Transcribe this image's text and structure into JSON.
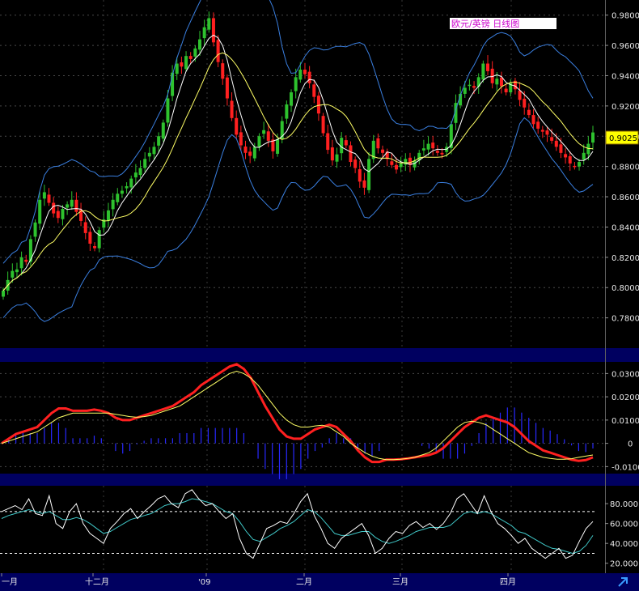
{
  "chart_data": [
    {
      "type": "candlestick",
      "title": "欧元/英镑  日线图",
      "last_value_label": "0.9025",
      "ylim": [
        0.76,
        0.99
      ],
      "yticks": [
        "0.9800",
        "0.9600",
        "0.9400",
        "0.9200",
        "0.9000",
        "0.8800",
        "0.8600",
        "0.8400",
        "0.8200",
        "0.8000",
        "0.7800"
      ],
      "overlays": [
        "bollinger-upper",
        "bollinger-lower",
        "moving-average-fast",
        "moving-average-slow"
      ],
      "colors": {
        "up": "#2ec22e",
        "down": "#ff2020",
        "bollinger": "#3a7fe0",
        "ma_fast": "#ffffff",
        "ma_slow": "#ffff66"
      },
      "closes": [
        0.798,
        0.805,
        0.811,
        0.812,
        0.82,
        0.817,
        0.832,
        0.843,
        0.858,
        0.863,
        0.856,
        0.849,
        0.846,
        0.852,
        0.855,
        0.858,
        0.85,
        0.844,
        0.836,
        0.829,
        0.826,
        0.838,
        0.845,
        0.851,
        0.858,
        0.862,
        0.864,
        0.867,
        0.872,
        0.876,
        0.879,
        0.885,
        0.889,
        0.893,
        0.9,
        0.909,
        0.925,
        0.942,
        0.948,
        0.946,
        0.953,
        0.951,
        0.958,
        0.964,
        0.972,
        0.978,
        0.962,
        0.949,
        0.938,
        0.925,
        0.912,
        0.901,
        0.894,
        0.889,
        0.887,
        0.893,
        0.9,
        0.904,
        0.897,
        0.89,
        0.898,
        0.91,
        0.921,
        0.929,
        0.939,
        0.944,
        0.941,
        0.935,
        0.926,
        0.915,
        0.902,
        0.891,
        0.884,
        0.888,
        0.899,
        0.894,
        0.883,
        0.879,
        0.87,
        0.866,
        0.885,
        0.897,
        0.892,
        0.889,
        0.885,
        0.881,
        0.878,
        0.882,
        0.885,
        0.881,
        0.884,
        0.889,
        0.892,
        0.895,
        0.892,
        0.889,
        0.888,
        0.893,
        0.908,
        0.922,
        0.928,
        0.932,
        0.934,
        0.932,
        0.939,
        0.948,
        0.943,
        0.935,
        0.938,
        0.933,
        0.929,
        0.935,
        0.931,
        0.924,
        0.919,
        0.914,
        0.908,
        0.905,
        0.903,
        0.901,
        0.897,
        0.893,
        0.889,
        0.886,
        0.882,
        0.88,
        0.883,
        0.889,
        0.895,
        0.9025
      ]
    },
    {
      "type": "line",
      "indicator": "MACD",
      "ylim": [
        -0.013,
        0.035
      ],
      "yticks": [
        "0.0300",
        "0.0200",
        "0.0100",
        "0",
        "-0.0100"
      ],
      "macd": [
        0.0,
        0.002,
        0.004,
        0.005,
        0.006,
        0.007,
        0.01,
        0.013,
        0.015,
        0.015,
        0.014,
        0.014,
        0.014,
        0.0145,
        0.014,
        0.013,
        0.011,
        0.01,
        0.01,
        0.011,
        0.012,
        0.013,
        0.014,
        0.015,
        0.016,
        0.018,
        0.02,
        0.022,
        0.025,
        0.027,
        0.029,
        0.031,
        0.033,
        0.034,
        0.032,
        0.028,
        0.022,
        0.016,
        0.011,
        0.006,
        0.003,
        0.002,
        0.002,
        0.004,
        0.006,
        0.007,
        0.008,
        0.007,
        0.004,
        0.001,
        -0.003,
        -0.006,
        -0.008,
        -0.008,
        -0.007,
        -0.007,
        -0.0068,
        -0.0065,
        -0.006,
        -0.0055,
        -0.005,
        -0.004,
        -0.002,
        0.001,
        0.004,
        0.007,
        0.009,
        0.011,
        0.012,
        0.011,
        0.01,
        0.009,
        0.007,
        0.004,
        0.001,
        -0.001,
        -0.003,
        -0.004,
        -0.005,
        -0.006,
        -0.007,
        -0.0075,
        -0.0072,
        -0.006
      ],
      "signal": [
        0.0,
        0.001,
        0.002,
        0.003,
        0.004,
        0.005,
        0.007,
        0.009,
        0.011,
        0.012,
        0.013,
        0.013,
        0.013,
        0.013,
        0.013,
        0.013,
        0.0125,
        0.012,
        0.0115,
        0.0112,
        0.0115,
        0.012,
        0.013,
        0.014,
        0.015,
        0.016,
        0.018,
        0.02,
        0.022,
        0.024,
        0.026,
        0.028,
        0.03,
        0.031,
        0.03,
        0.028,
        0.025,
        0.021,
        0.017,
        0.013,
        0.01,
        0.008,
        0.007,
        0.007,
        0.0075,
        0.0078,
        0.007,
        0.005,
        0.003,
        0.0,
        -0.002,
        -0.004,
        -0.0055,
        -0.0065,
        -0.007,
        -0.007,
        -0.0068,
        -0.0065,
        -0.006,
        -0.005,
        -0.004,
        -0.002,
        0.001,
        0.004,
        0.007,
        0.009,
        0.0095,
        0.009,
        0.008,
        0.006,
        0.004,
        0.002,
        0.0,
        -0.002,
        -0.004,
        -0.005,
        -0.006,
        -0.0065,
        -0.0068,
        -0.0068,
        -0.0066,
        -0.006,
        -0.0055,
        -0.005
      ],
      "colors": {
        "macd": "#ff2020",
        "signal": "#ffff66",
        "histogram": "#2828ff"
      }
    },
    {
      "type": "line",
      "indicator": "Stochastic",
      "ylim": [
        10,
        98
      ],
      "yticks": [
        "80.000",
        "60.000",
        "40.000",
        "20.000"
      ],
      "reference_levels": [
        72,
        30
      ],
      "k": [
        72,
        75,
        78,
        74,
        85,
        70,
        68,
        88,
        60,
        55,
        72,
        80,
        60,
        50,
        45,
        40,
        55,
        62,
        70,
        75,
        65,
        72,
        78,
        85,
        88,
        80,
        76,
        90,
        94,
        85,
        78,
        80,
        72,
        65,
        70,
        45,
        30,
        25,
        40,
        55,
        58,
        62,
        60,
        70,
        82,
        90,
        68,
        55,
        40,
        35,
        45,
        50,
        55,
        60,
        48,
        30,
        35,
        45,
        52,
        50,
        58,
        62,
        56,
        60,
        54,
        60,
        70,
        85,
        90,
        80,
        70,
        88,
        72,
        60,
        55,
        48,
        40,
        45,
        35,
        30,
        25,
        30,
        35,
        25,
        28,
        42,
        55,
        62
      ],
      "d": [
        65,
        68,
        70,
        72,
        74,
        72,
        70,
        72,
        68,
        64,
        64,
        66,
        64,
        60,
        55,
        50,
        52,
        56,
        60,
        64,
        66,
        68,
        70,
        74,
        78,
        80,
        80,
        82,
        85,
        84,
        82,
        80,
        76,
        72,
        70,
        62,
        52,
        44,
        42,
        46,
        50,
        55,
        58,
        62,
        68,
        74,
        72,
        66,
        58,
        50,
        48,
        48,
        50,
        52,
        52,
        46,
        42,
        40,
        42,
        45,
        48,
        52,
        54,
        56,
        56,
        56,
        58,
        64,
        70,
        72,
        70,
        72,
        70,
        66,
        62,
        58,
        52,
        50,
        46,
        42,
        38,
        35,
        34,
        32,
        30,
        32,
        38,
        48
      ],
      "colors": {
        "k": "#ffffff",
        "d": "#40c8c8"
      }
    }
  ],
  "x_axis_labels": [
    "一月",
    "十二月",
    "'09",
    "二月",
    "三月",
    "四月"
  ]
}
